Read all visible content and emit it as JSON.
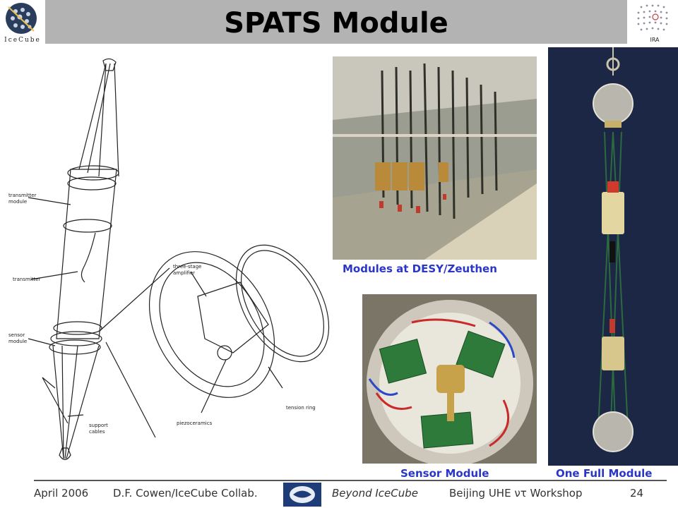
{
  "header": {
    "title": "SPATS Module",
    "left_logo_text": "IceCube",
    "right_logo_text": "IRA"
  },
  "drawing": {
    "labels": {
      "transmitter_module": [
        "transmitter",
        "module"
      ],
      "transmitter": "transmitter",
      "sensor_module": [
        "sensor",
        "module"
      ],
      "support_cables": [
        "support",
        "cables"
      ],
      "three_stage_amplifier": [
        "three-stage",
        "amplifier"
      ],
      "tension_ring": "tension ring",
      "piezoceramics": "piezoceramics"
    }
  },
  "captions": {
    "desy": "Modules at DESY/Zeuthen",
    "sensor": "Sensor Module",
    "full": "One Full Module"
  },
  "footer": {
    "date": "April 2006",
    "author": "D.F. Cowen/IceCube Collab.",
    "event": "Beyond IceCube",
    "workshop": "Beijing UHE ντ Workshop",
    "page": "24"
  },
  "colors": {
    "title_bar": "#b3b3b3",
    "caption": "#2a36c8",
    "footer_text": "#333333"
  },
  "icons": {
    "left_logo": "icecube-logo-icon",
    "right_logo": "ira-grid-logo-icon",
    "footer_logo": "penn-state-logo-icon"
  }
}
